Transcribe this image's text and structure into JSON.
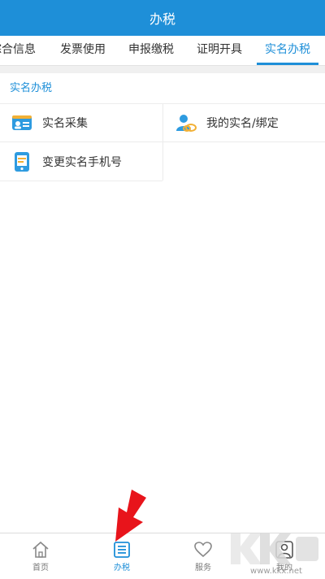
{
  "header": {
    "title": "办税"
  },
  "tabs": [
    {
      "label": "综合信息"
    },
    {
      "label": "发票使用"
    },
    {
      "label": "申报缴税"
    },
    {
      "label": "证明开具"
    },
    {
      "label": "实名办税",
      "active": true
    }
  ],
  "section": {
    "title": "实名办税"
  },
  "items": [
    {
      "label": "实名采集",
      "icon": "id-card-icon"
    },
    {
      "label": "我的实名/绑定",
      "icon": "user-link-icon"
    },
    {
      "label": "变更实名手机号",
      "icon": "phone-edit-icon"
    }
  ],
  "bottom_nav": [
    {
      "label": "首页",
      "icon": "home-icon"
    },
    {
      "label": "办税",
      "icon": "list-icon",
      "active": true
    },
    {
      "label": "服务",
      "icon": "heart-icon"
    },
    {
      "label": "我的",
      "icon": "person-icon"
    }
  ],
  "watermark": {
    "logo_text": "KK下载",
    "url": "www.kkx.net"
  },
  "colors": {
    "primary": "#1e8fd8",
    "arrow": "#e8141b"
  }
}
